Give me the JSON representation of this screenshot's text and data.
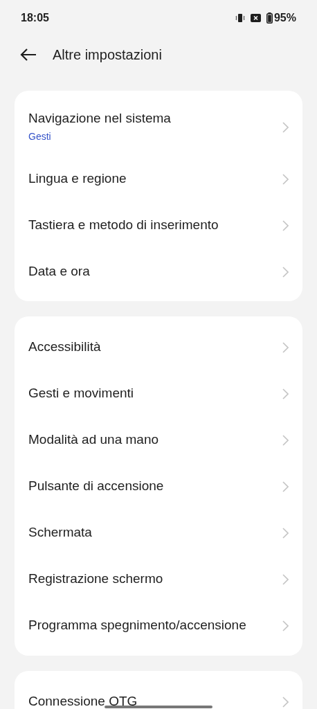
{
  "status_bar": {
    "time": "18:05",
    "battery_text": "95%"
  },
  "header": {
    "title": "Altre impostazioni"
  },
  "groups": [
    {
      "items": [
        {
          "title": "Navigazione nel sistema",
          "subtitle": "Gesti"
        },
        {
          "title": "Lingua e regione"
        },
        {
          "title": "Tastiera e metodo di inserimento"
        },
        {
          "title": "Data e ora"
        }
      ]
    },
    {
      "items": [
        {
          "title": "Accessibilità"
        },
        {
          "title": "Gesti e movimenti"
        },
        {
          "title": "Modalità ad una mano"
        },
        {
          "title": "Pulsante di accensione"
        },
        {
          "title": "Schermata"
        },
        {
          "title": "Registrazione schermo"
        },
        {
          "title": "Programma spegnimento/accensione"
        }
      ]
    },
    {
      "items": [
        {
          "title": "Connessione OTG"
        }
      ]
    }
  ]
}
